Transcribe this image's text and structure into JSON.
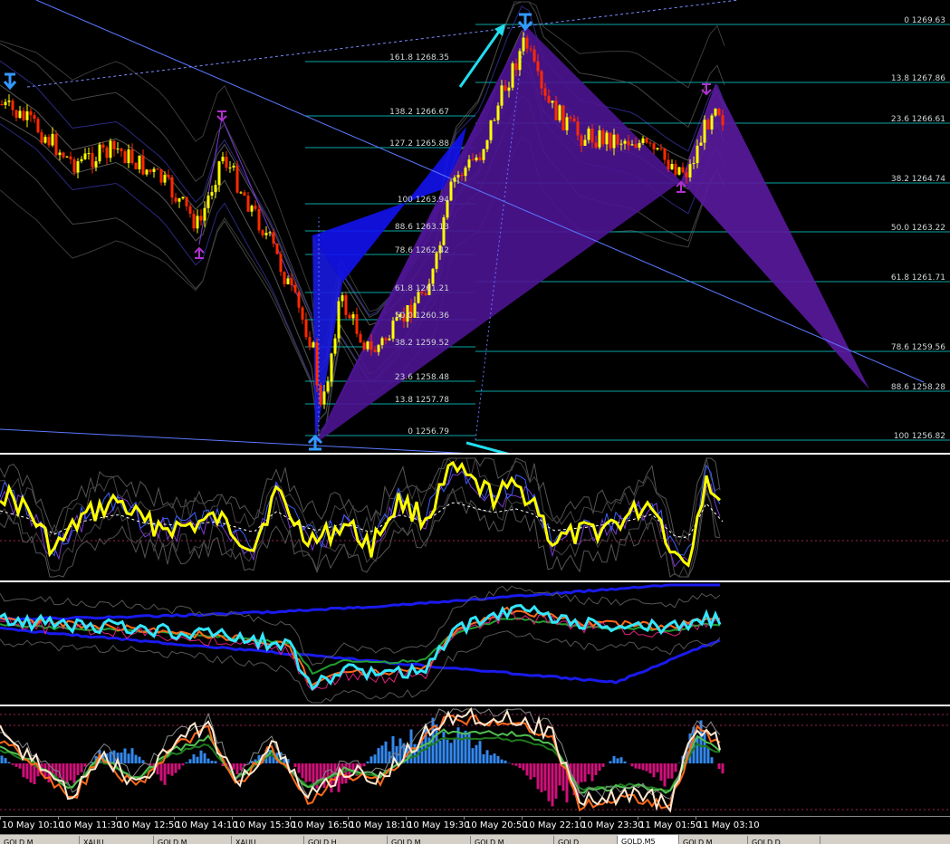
{
  "price_pane": {
    "left_fibs": [
      {
        "text": "161.8 1268.35"
      },
      {
        "text": "138.2 1266.67"
      },
      {
        "text": "127.2 1265.88"
      },
      {
        "text": "100 1263.94"
      },
      {
        "text": "88.6 1263.13"
      },
      {
        "text": "78.6 1262.42"
      },
      {
        "text": "61.8 1261.21"
      },
      {
        "text": "50.0 1260.36"
      },
      {
        "text": "38.2 1259.52"
      },
      {
        "text": "23.6 1258.48"
      },
      {
        "text": "13.8 1257.78"
      },
      {
        "text": "0 1256.79"
      }
    ],
    "right_fibs": [
      {
        "text": "0 1269.63"
      },
      {
        "text": "13.8 1267.86"
      },
      {
        "text": "23.6 1266.61"
      },
      {
        "text": "38.2 1264.74"
      },
      {
        "text": "50.0 1263.22"
      },
      {
        "text": "61.8 1261.71"
      },
      {
        "text": "78.6 1259.56"
      },
      {
        "text": "88.6 1258.28"
      },
      {
        "text": "100 1256.82"
      }
    ]
  },
  "time_axis": {
    "labels": [
      "10 May 10:10",
      "10 May 11:30",
      "10 May 12:50",
      "10 May 14:10",
      "10 May 15:30",
      "10 May 16:50",
      "10 May 18:10",
      "10 May 19:30",
      "10 May 20:50",
      "10 May 22:10",
      "10 May 23:30",
      "11 May 01:50",
      "11 May 03:10"
    ]
  },
  "tabs": [
    {
      "label": "GOLD,M..."
    },
    {
      "label": "XAUU..."
    },
    {
      "label": "GOLD,M..."
    },
    {
      "label": "XAUU..."
    },
    {
      "label": "GOLD,H..."
    },
    {
      "label": "GOLD,M..."
    },
    {
      "label": "GOLD,M..."
    },
    {
      "label": "GOLD..."
    },
    {
      "label": "GOLD,M5"
    },
    {
      "label": "GOLD,M..."
    },
    {
      "label": "GOLD,D..."
    }
  ],
  "colors": {
    "bull_candle": "#ffff00",
    "bear_candle": "#ff2a00",
    "pattern_purple": "#5a1a9e",
    "pattern_blue": "#1010e8",
    "fib_line": "#0aa6a6",
    "trend_line": "#5a78ff",
    "arrow_up": "#3399ff",
    "arrow_magenta": "#b030d0",
    "cyan_arrow": "#22ddee",
    "osc_yellow": "#ffff00",
    "osc_cyan": "#33e6ff",
    "hist_blue": "#3388ee",
    "hist_magenta": "#d0107a"
  }
}
